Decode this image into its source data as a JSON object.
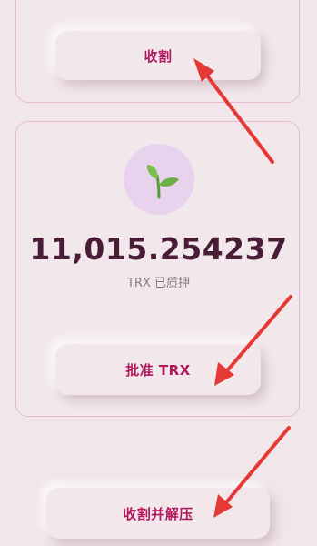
{
  "buttons": {
    "harvest": "收割",
    "approve": "批准 TRX",
    "harvest_unstake": "收割并解压"
  },
  "stake": {
    "amount": "11,015.254237",
    "label": "TRX 已质押"
  },
  "icons": {
    "token_logo": "sprout-icon"
  },
  "colors": {
    "accent": "#b0195c",
    "amount_text": "#4a1d37",
    "arrow": "#e53935",
    "card_border": "#eab8d6",
    "background": "#f1e6ea"
  }
}
